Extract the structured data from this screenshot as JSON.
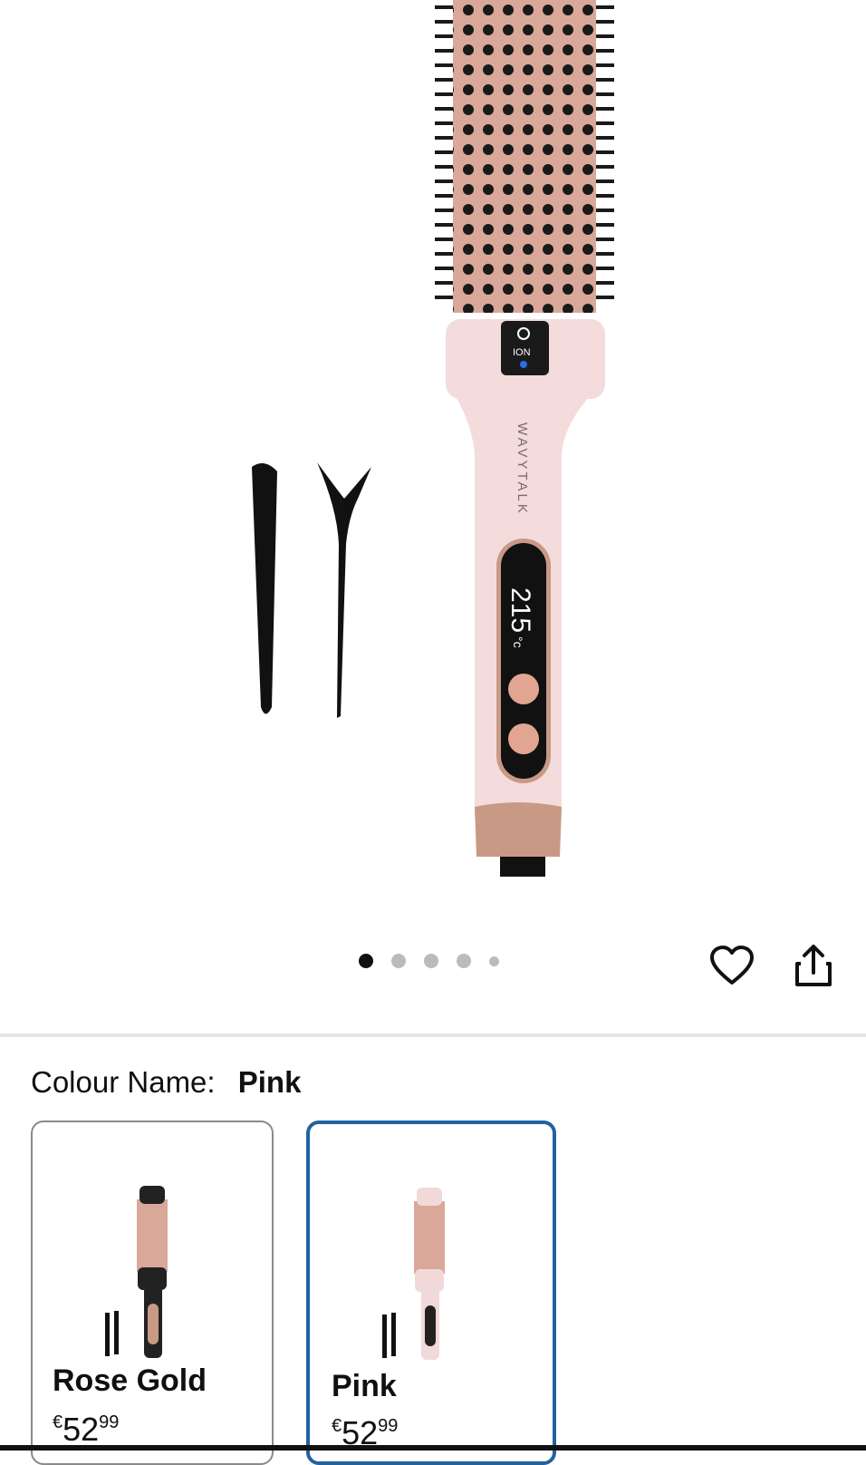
{
  "product": {
    "brand_text": "WAVYTALK",
    "display_temp": "215",
    "display_unit": "°c",
    "ion_label": "ION"
  },
  "carousel": {
    "total": 5,
    "active": 1
  },
  "actions": {
    "wishlist_icon": "heart-icon",
    "share_icon": "share-icon"
  },
  "colour": {
    "label": "Colour Name:",
    "selected": "Pink"
  },
  "options": [
    {
      "name": "Rose Gold",
      "currency": "€",
      "whole": "52",
      "fraction": "99"
    },
    {
      "name": "Pink",
      "currency": "€",
      "whole": "52",
      "fraction": "99"
    }
  ],
  "colors": {
    "accent_border": "#2162a1",
    "pink": "#f2d9d9",
    "rose": "#c89a86"
  }
}
